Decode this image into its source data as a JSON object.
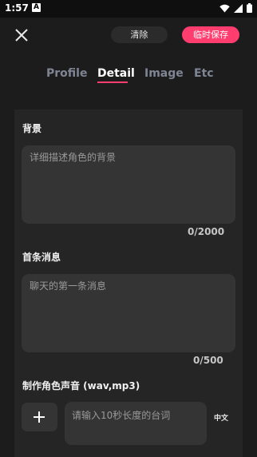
{
  "status_bar": {
    "time": "1:57",
    "notification_letter": "A"
  },
  "toolbar": {
    "clear_label": "清除",
    "save_label": "临时保存"
  },
  "tabs": [
    {
      "label": "Profile",
      "active": false
    },
    {
      "label": "Detail",
      "active": true
    },
    {
      "label": "Image",
      "active": false
    },
    {
      "label": "Etc",
      "active": false
    }
  ],
  "background_section": {
    "label": "背景",
    "placeholder": "详细描述角色的背景",
    "counter": "0/2000"
  },
  "first_message_section": {
    "label": "首条消息",
    "placeholder": "聊天的第一条消息",
    "counter": "0/500"
  },
  "voice_section": {
    "label": "制作角色声音 (wav,mp3)",
    "line_placeholder": "请输入10秒长度的台词",
    "language_label": "中文"
  },
  "colors": {
    "accent": "#ff3d6e",
    "background": "#1c1c1c",
    "panel": "#252525",
    "field": "#343434"
  },
  "icons": [
    "close-icon",
    "plus-icon",
    "wifi-icon",
    "signal-icon",
    "battery-icon"
  ]
}
